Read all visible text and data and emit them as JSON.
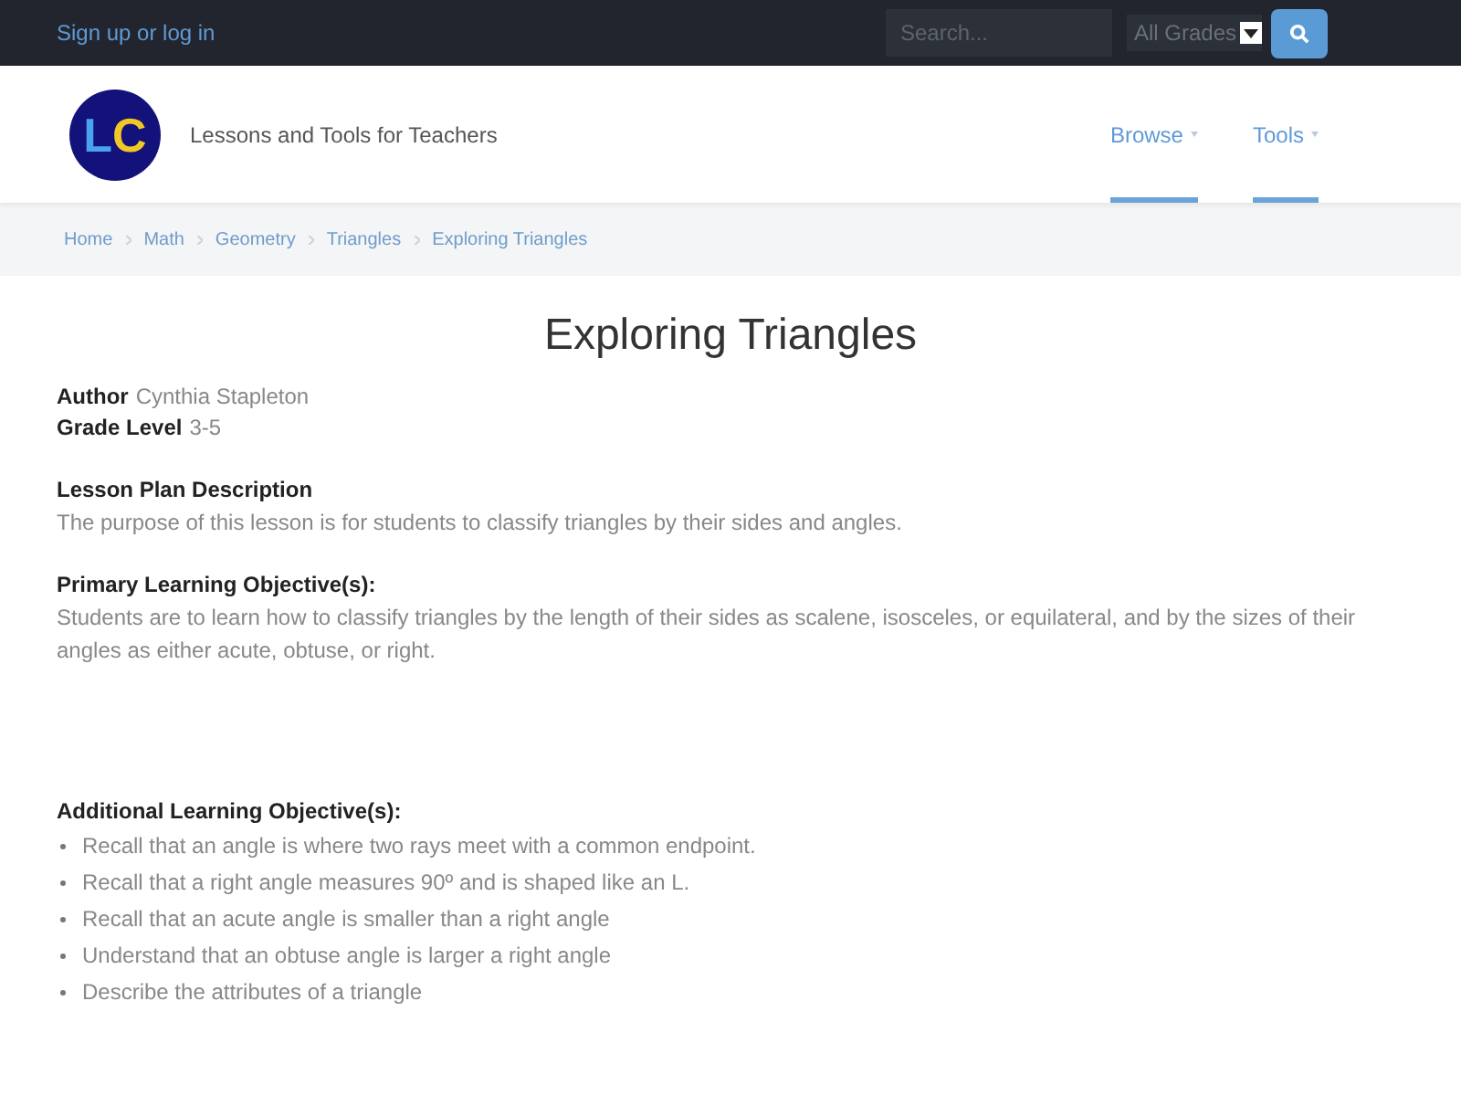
{
  "top_bar": {
    "account_link": "Sign up or log in",
    "search": {
      "placeholder": "Search..."
    },
    "grade_select": {
      "value": "All Grades"
    }
  },
  "header": {
    "logo_letters": [
      "L",
      "C"
    ],
    "tagline": "Lessons and Tools for Teachers",
    "nav": [
      {
        "label": "Browse"
      },
      {
        "label": "Tools"
      }
    ]
  },
  "breadcrumb": [
    "Home",
    "Math",
    "Geometry",
    "Triangles",
    "Exploring Triangles"
  ],
  "title": "Exploring Triangles",
  "meta": [
    {
      "label": "Author",
      "value": "Cynthia Stapleton"
    },
    {
      "label": "Grade Level",
      "value": "3-5"
    }
  ],
  "sections": [
    {
      "heading": "Lesson Plan Description",
      "text": "The purpose of this lesson is for students to classify triangles by their sides and angles."
    },
    {
      "heading": "Primary Learning Objective(s):",
      "text": "Students are to learn how to classify triangles by the length of their sides as scalene, isosceles, or equilateral, and by the sizes of their angles as either acute, obtuse, or right."
    }
  ],
  "additional": {
    "heading": "Additional Learning Objective(s):",
    "items": [
      "Recall that an angle is where two rays meet with a common endpoint.",
      "Recall that a right angle measures 90º and is shaped like an L.",
      "Recall that an acute angle is smaller than a right angle",
      "Understand that an obtuse angle is larger a right angle",
      "Describe the attributes of a triangle"
    ]
  }
}
